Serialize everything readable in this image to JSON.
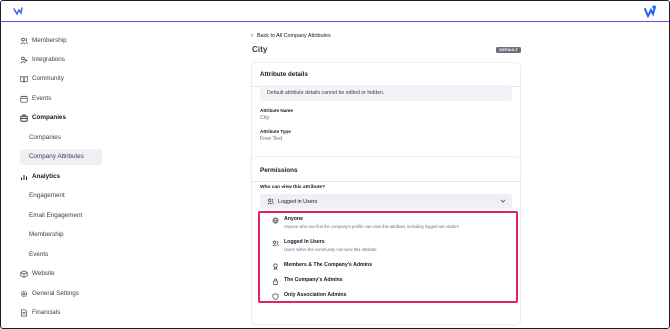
{
  "colors": {
    "accent": "#7c3aed",
    "brand_blue": "#2563eb",
    "highlight_border": "#e0245e",
    "active_bg": "#eef0f4"
  },
  "sidebar": {
    "items": [
      {
        "label": "Membership",
        "icon": "users-icon"
      },
      {
        "label": "Integrations",
        "icon": "integrations-icon"
      },
      {
        "label": "Community",
        "icon": "book-icon"
      },
      {
        "label": "Events",
        "icon": "calendar-icon"
      },
      {
        "label": "Companies",
        "icon": "building-icon"
      },
      {
        "label": "Companies",
        "icon": ""
      },
      {
        "label": "Company Attributes",
        "icon": ""
      },
      {
        "label": "Analytics",
        "icon": "chart-icon"
      },
      {
        "label": "Engagement",
        "icon": ""
      },
      {
        "label": "Email Engagement",
        "icon": ""
      },
      {
        "label": "Membership",
        "icon": ""
      },
      {
        "label": "Events",
        "icon": ""
      },
      {
        "label": "Website",
        "icon": "cube-icon"
      },
      {
        "label": "General Settings",
        "icon": "gear-icon"
      },
      {
        "label": "Financials",
        "icon": "document-icon"
      }
    ]
  },
  "header": {
    "back_label": "Back to All Company Attributes",
    "title": "City",
    "badge": "DEFAULT"
  },
  "details": {
    "heading": "Attribute details",
    "notice": "Default attribute details cannot be edited or hidden.",
    "name_label": "Attribute Name",
    "name_value": "City",
    "type_label": "Attribute Type",
    "type_value": "Free Text"
  },
  "permissions": {
    "heading": "Permissions",
    "question": "Who can view this attribute?",
    "selected": "Logged in Users",
    "options": [
      {
        "title": "Anyone",
        "desc": "Anyone who can find the company's profile can view this attribute, including logged out visitors",
        "icon": "globe-icon"
      },
      {
        "title": "Logged In Users",
        "desc": "Users within the community can view this attribute",
        "icon": "users-icon"
      },
      {
        "title": "Members & The Company's Admins",
        "desc": "",
        "icon": "badge-icon"
      },
      {
        "title": "The Company's Admins",
        "desc": "",
        "icon": "lock-icon"
      },
      {
        "title": "Only Association Admins",
        "desc": "",
        "icon": "shield-icon"
      }
    ]
  }
}
